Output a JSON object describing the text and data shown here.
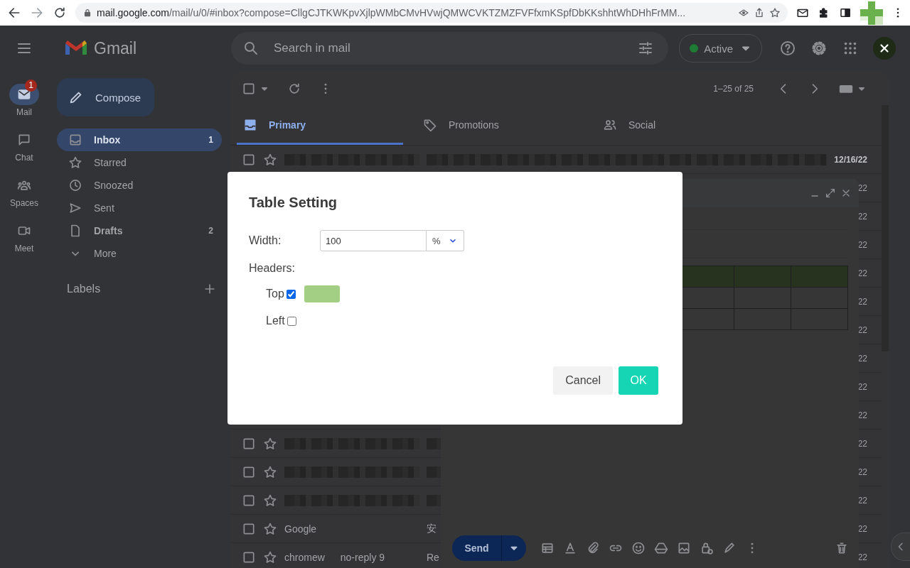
{
  "browser": {
    "host": "mail.google.com",
    "path": "/mail/u/0/#inbox?compose=CllgCJTKWKpvXjlpWMbCMvHVwjQMWCVKTZMZFVFfxmKSpfDbKKshhtWhDHhFrMM..."
  },
  "header": {
    "app_name": "Gmail",
    "search_placeholder": "Search in mail",
    "status": "Active"
  },
  "rail": [
    {
      "label": "Mail",
      "kind": "mail",
      "selected": true,
      "badge": "1"
    },
    {
      "label": "Chat",
      "kind": "chat",
      "selected": false
    },
    {
      "label": "Spaces",
      "kind": "spaces",
      "selected": false
    },
    {
      "label": "Meet",
      "kind": "meet",
      "selected": false
    }
  ],
  "compose_button": "Compose",
  "folders": [
    {
      "label": "Inbox",
      "kind": "inbox",
      "count": "1",
      "selected": true,
      "unread": true
    },
    {
      "label": "Starred",
      "kind": "starred",
      "selected": false,
      "unread": false
    },
    {
      "label": "Snoozed",
      "kind": "snoozed",
      "selected": false,
      "unread": false
    },
    {
      "label": "Sent",
      "kind": "sent",
      "selected": false,
      "unread": false
    },
    {
      "label": "Drafts",
      "kind": "drafts",
      "count": "2",
      "selected": false,
      "unread": true
    },
    {
      "label": "More",
      "kind": "more",
      "selected": false,
      "unread": false
    }
  ],
  "labels_heading": "Labels",
  "list_toolbar": {
    "checked": false,
    "range": "1–25 of 25"
  },
  "tabs": [
    {
      "label": "Primary",
      "kind": "primary",
      "selected": true
    },
    {
      "label": "Promotions",
      "kind": "promotions",
      "selected": false
    },
    {
      "label": "Social",
      "kind": "social",
      "selected": false
    }
  ],
  "rows": [
    {
      "kind": "blurred_wide",
      "checked": false,
      "date": "12/16/22",
      "unread": true
    },
    {
      "kind": "covered",
      "date": "22",
      "unread": false
    },
    {
      "kind": "covered",
      "date": "22",
      "unread": false
    },
    {
      "kind": "covered",
      "date": "22",
      "unread": false
    },
    {
      "kind": "covered",
      "date": "22",
      "unread": false
    },
    {
      "kind": "covered",
      "date": "22",
      "unread": false
    },
    {
      "kind": "covered",
      "date": "22",
      "unread": false
    },
    {
      "kind": "covered",
      "date": "22",
      "unread": false
    },
    {
      "kind": "covered",
      "date": "22",
      "unread": false
    },
    {
      "kind": "covered",
      "date": "22",
      "unread": false
    },
    {
      "kind": "blurred",
      "checked": false,
      "date": "22",
      "unread": false
    },
    {
      "kind": "blurred",
      "checked": false,
      "date": "22",
      "unread": false
    },
    {
      "kind": "blurred",
      "checked": false,
      "date": "22",
      "unread": false
    },
    {
      "kind": "full",
      "checked": false,
      "senders": [
        "Google"
      ],
      "subject": "安",
      "date": "22",
      "unread": false
    },
    {
      "kind": "full",
      "checked": false,
      "senders": [
        "chromew",
        "no-reply 9"
      ],
      "subject": "Re",
      "date": "22",
      "unread": false
    }
  ],
  "compose": {
    "send_label": "Send"
  },
  "dialog": {
    "title": "Table Setting",
    "width_label": "Width:",
    "width_value": "100",
    "unit": "%",
    "headers_label": "Headers:",
    "headers": [
      {
        "label": "Top",
        "checked": true,
        "color": "#a3cf85"
      },
      {
        "label": "Left",
        "checked": false
      }
    ],
    "buttons": [
      {
        "label": "Cancel",
        "kind": "secondary"
      },
      {
        "label": "OK",
        "kind": "primary"
      }
    ]
  }
}
